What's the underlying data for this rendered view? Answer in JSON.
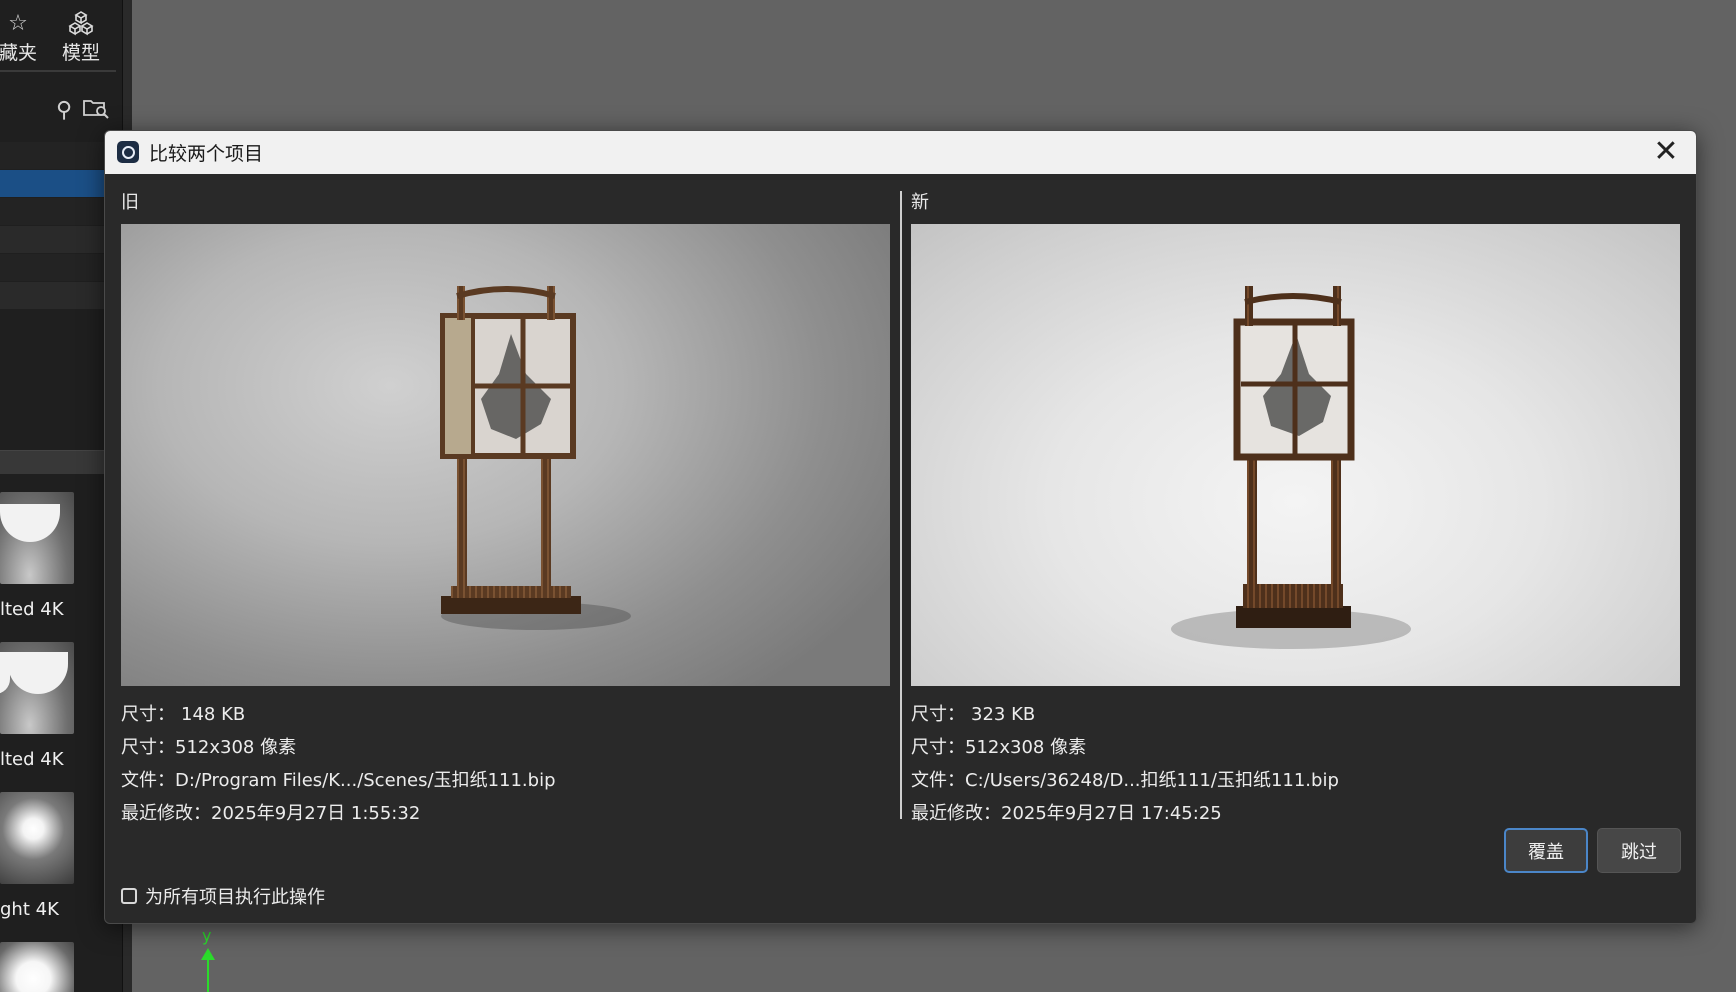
{
  "left_panel": {
    "toolbar": {
      "favorites_label": "藏夹",
      "models_label": "模型"
    },
    "thumbnails": [
      {
        "label": "lted 4K"
      },
      {
        "label": "lted 4K"
      },
      {
        "label": "ght 4K"
      },
      {
        "label": ""
      }
    ]
  },
  "viewport": {
    "axis_label": "y"
  },
  "dialog": {
    "title": "比较两个项目",
    "old": {
      "header": "旧",
      "size_label": "尺寸：",
      "size_value": "148 KB",
      "dims_label": "尺寸：",
      "dims_value": "512x308 像素",
      "file_label": "文件：",
      "file_value": "D:/Program Files/K.../Scenes/玉扣纸111.bip",
      "modified_label": "最近修改：",
      "modified_value": "2025年9月27日 1:55:32"
    },
    "new": {
      "header": "新",
      "size_label": "尺寸：",
      "size_value": "323 KB",
      "dims_label": "尺寸：",
      "dims_value": "512x308 像素",
      "file_label": "文件：",
      "file_value": "C:/Users/36248/D...扣纸111/玉扣纸111.bip",
      "modified_label": "最近修改：",
      "modified_value": "2025年9月27日 17:45:25"
    },
    "buttons": {
      "overwrite": "覆盖",
      "skip": "跳过"
    },
    "apply_all_label": "为所有项目执行此操作",
    "apply_all_checked": false
  },
  "colors": {
    "accent": "#4b86c8",
    "selection": "#1b4f86",
    "axis_y": "#2bdb2b"
  }
}
